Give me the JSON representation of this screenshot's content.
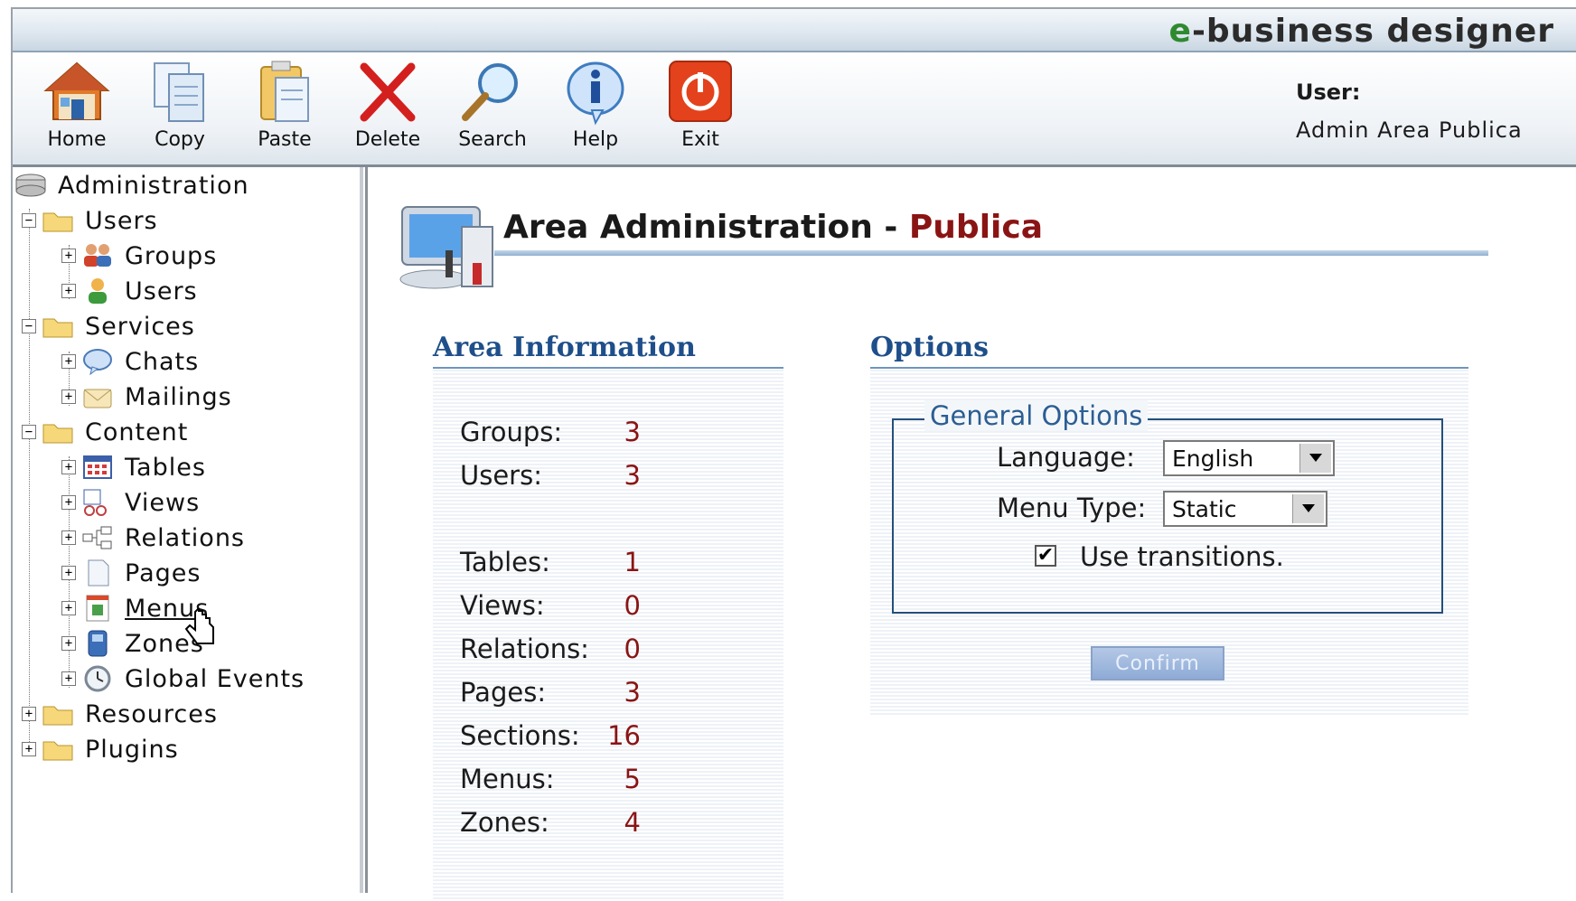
{
  "header": {
    "brand_prefix": "e",
    "brand_rest": "-business designer"
  },
  "toolbar": {
    "items": [
      {
        "label": "Home",
        "icon": "home-icon"
      },
      {
        "label": "Copy",
        "icon": "copy-icon"
      },
      {
        "label": "Paste",
        "icon": "paste-icon"
      },
      {
        "label": "Delete",
        "icon": "delete-icon"
      },
      {
        "label": "Search",
        "icon": "search-icon"
      },
      {
        "label": "Help",
        "icon": "help-icon"
      },
      {
        "label": "Exit",
        "icon": "exit-icon"
      }
    ]
  },
  "user": {
    "label": "User:",
    "name": "Admin Area Publica"
  },
  "sidebar": {
    "root": "Administration",
    "tree": [
      {
        "label": "Users"
      },
      {
        "label": "Groups"
      },
      {
        "label": "Users"
      },
      {
        "label": "Services"
      },
      {
        "label": "Chats"
      },
      {
        "label": "Mailings"
      },
      {
        "label": "Content"
      },
      {
        "label": "Tables"
      },
      {
        "label": "Views"
      },
      {
        "label": "Relations"
      },
      {
        "label": "Pages"
      },
      {
        "label": "Menus"
      },
      {
        "label": "Zones"
      },
      {
        "label": "Global Events"
      },
      {
        "label": "Resources"
      },
      {
        "label": "Plugins"
      }
    ]
  },
  "page": {
    "title": "Area Administration - ",
    "title_accent": "Publica"
  },
  "area_info": {
    "heading": "Area Information",
    "rows": [
      {
        "label": "Groups:",
        "value": "3"
      },
      {
        "label": "Users:",
        "value": "3"
      },
      {
        "label": "Tables:",
        "value": "1"
      },
      {
        "label": "Views:",
        "value": "0"
      },
      {
        "label": "Relations:",
        "value": "0"
      },
      {
        "label": "Pages:",
        "value": "3"
      },
      {
        "label": "Sections:",
        "value": "16"
      },
      {
        "label": "Menus:",
        "value": "5"
      },
      {
        "label": "Zones:",
        "value": "4"
      }
    ]
  },
  "options": {
    "heading": "Options",
    "general_legend": "General Options",
    "language_label": "Language:",
    "language_value": "English",
    "menu_type_label": "Menu Type:",
    "menu_type_value": "Static",
    "transitions_label": "Use transitions.",
    "transitions_checked": true,
    "confirm_label": "Confirm"
  },
  "colors": {
    "accent_red": "#8a1414",
    "heading_blue": "#1f4f8a",
    "brand_green": "#2f8a2f"
  }
}
